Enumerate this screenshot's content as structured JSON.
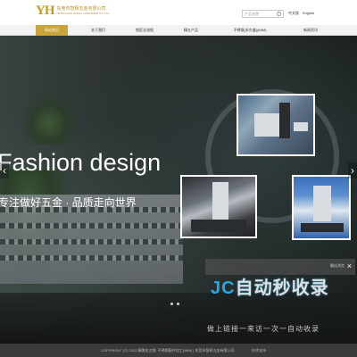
{
  "header": {
    "logo_mark": "YH",
    "logo_text": "东莞市智辉五金有限公司",
    "logo_sub": "DONGGUAN ZHIHUI HARDWARE CO.,LTD",
    "search_placeholder": "产品名称",
    "lang_cn": "中文版",
    "lang_en": "English"
  },
  "nav": {
    "items": [
      {
        "label": "网站首页"
      },
      {
        "label": "关于我们"
      },
      {
        "label": "锁匠全流程"
      },
      {
        "label": "精五产品"
      },
      {
        "label": "不锈钢(米东盒)(MIM)"
      },
      {
        "label": "新闻资讯"
      }
    ]
  },
  "hero": {
    "headline": "Fashion design",
    "subline": "专注做好五金 · 品质走向世界",
    "prev_arrow": "‹",
    "next_arrow": "›",
    "slides": 2
  },
  "watermark": {
    "label": "最佳浏览",
    "close": "×",
    "brand_left": "JC",
    "brand_right": "自动秒收录",
    "tagline": "做上链接一来访一次一自动收录"
  },
  "footer": {
    "copyright": "COPYRIGHT (©) 2022 精美金五钢, 不锈钢配件加工(MIM) | 东莞市智辉五金有限公司",
    "link": "技术支持"
  },
  "colors": {
    "accent": "#c8a43a",
    "footer_bg": "#3a3a3a"
  }
}
